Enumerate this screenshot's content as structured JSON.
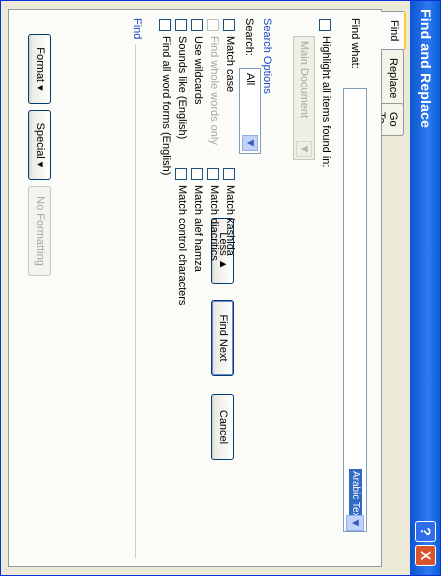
{
  "window": {
    "title": "Find and Replace",
    "help_label": "?",
    "close_label": "X"
  },
  "tabs": [
    {
      "label": "Find"
    },
    {
      "label": "Replace"
    },
    {
      "label": "Go To"
    }
  ],
  "find": {
    "label": "Find what:",
    "selected_text": "Arabic Text",
    "dropdown_icon": "chevron-down-icon"
  },
  "highlight": {
    "checkbox_label": "Highlight all items found in:",
    "scope_value": "Main Document",
    "scope_icon": "chevron-down-icon"
  },
  "buttons": {
    "less": "Less ▲",
    "find_next": "Find Next",
    "cancel": "Cancel"
  },
  "search_options": {
    "heading": "Search Options",
    "search_label": "Search:",
    "search_value": "All",
    "left": [
      {
        "label": "Match case",
        "enabled": true
      },
      {
        "label": "Find whole words only",
        "enabled": false
      },
      {
        "label": "Use wildcards",
        "enabled": true
      },
      {
        "label": "Sounds like (English)",
        "enabled": true
      },
      {
        "label": "Find all word forms (English)",
        "enabled": true
      }
    ],
    "right": [
      {
        "label": "Match kashida"
      },
      {
        "label": "Match diacritics"
      },
      {
        "label": "Match alef hamza"
      },
      {
        "label": "Match control characters"
      }
    ]
  },
  "find_section": {
    "heading": "Find",
    "format": "Format ▾",
    "special": "Special ▾",
    "no_formatting": "No Formatting"
  },
  "colors": {
    "titlebar": "#0b54d0",
    "dialog_bg": "#ece9d8",
    "link_blue": "#1e48c8",
    "close_red": "#d9532c"
  }
}
